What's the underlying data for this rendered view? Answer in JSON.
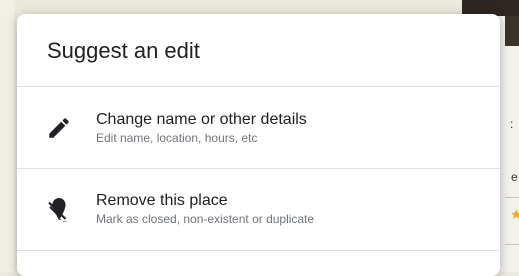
{
  "background": {
    "fragment_1": ":",
    "fragment_2": "e",
    "star": "★"
  },
  "dialog": {
    "title": "Suggest an edit",
    "options": [
      {
        "icon": "pencil-icon",
        "label": "Change name or other details",
        "sublabel": "Edit name, location, hours, etc"
      },
      {
        "icon": "remove-place-icon",
        "label": "Remove this place",
        "sublabel": "Mark as closed, non-existent or duplicate"
      }
    ]
  },
  "colors": {
    "dialog_background": "#ffffff",
    "title_text": "#202124",
    "secondary_text": "#70757a",
    "divider": "#e0e0e0",
    "page_background": "#ebe8dc"
  }
}
